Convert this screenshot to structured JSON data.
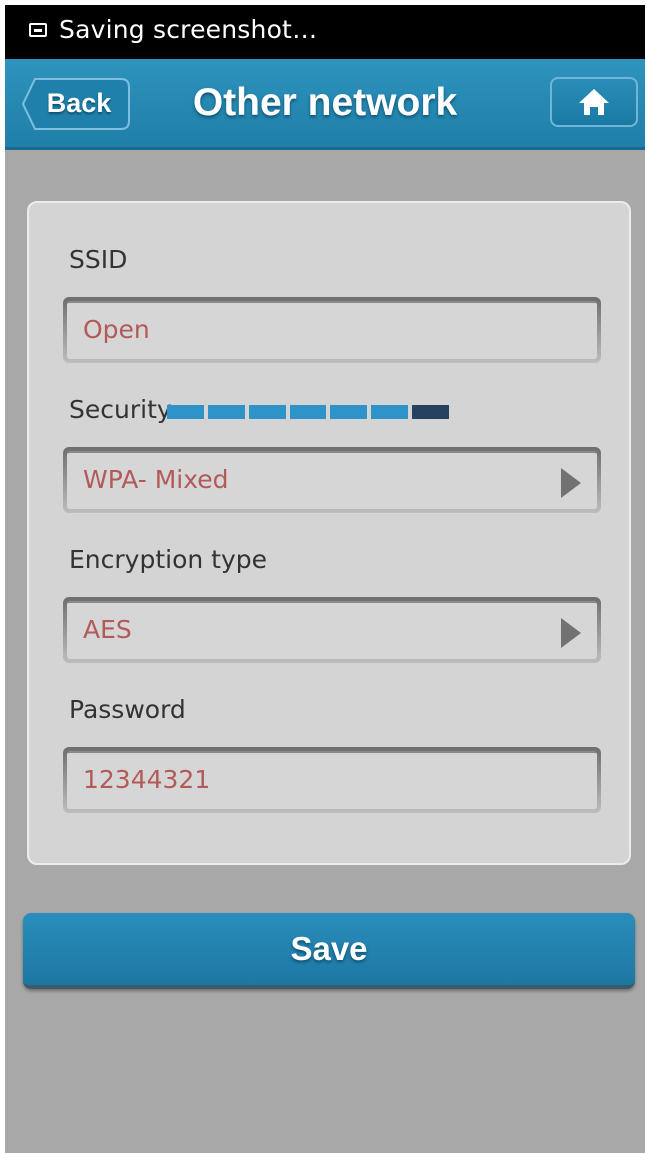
{
  "status_bar": {
    "icon": "screenshot-icon",
    "text": "Saving screenshot…"
  },
  "header": {
    "back_label": "Back",
    "title": "Other network",
    "home_icon": "home-icon"
  },
  "form": {
    "ssid": {
      "label": "SSID",
      "value": "Open"
    },
    "security": {
      "label": "Security",
      "value": "WPA- Mixed"
    },
    "encryption": {
      "label": "Encryption type",
      "value": "AES"
    },
    "password": {
      "label": "Password",
      "value": "12344321"
    }
  },
  "loading_indicator": {
    "segments": 7,
    "active_segment": 7
  },
  "save_label": "Save",
  "colors": {
    "header": "#1f7fa8",
    "field_text": "#b25a5a",
    "background": "#a8a8a8",
    "card": "#d4d4d4"
  }
}
